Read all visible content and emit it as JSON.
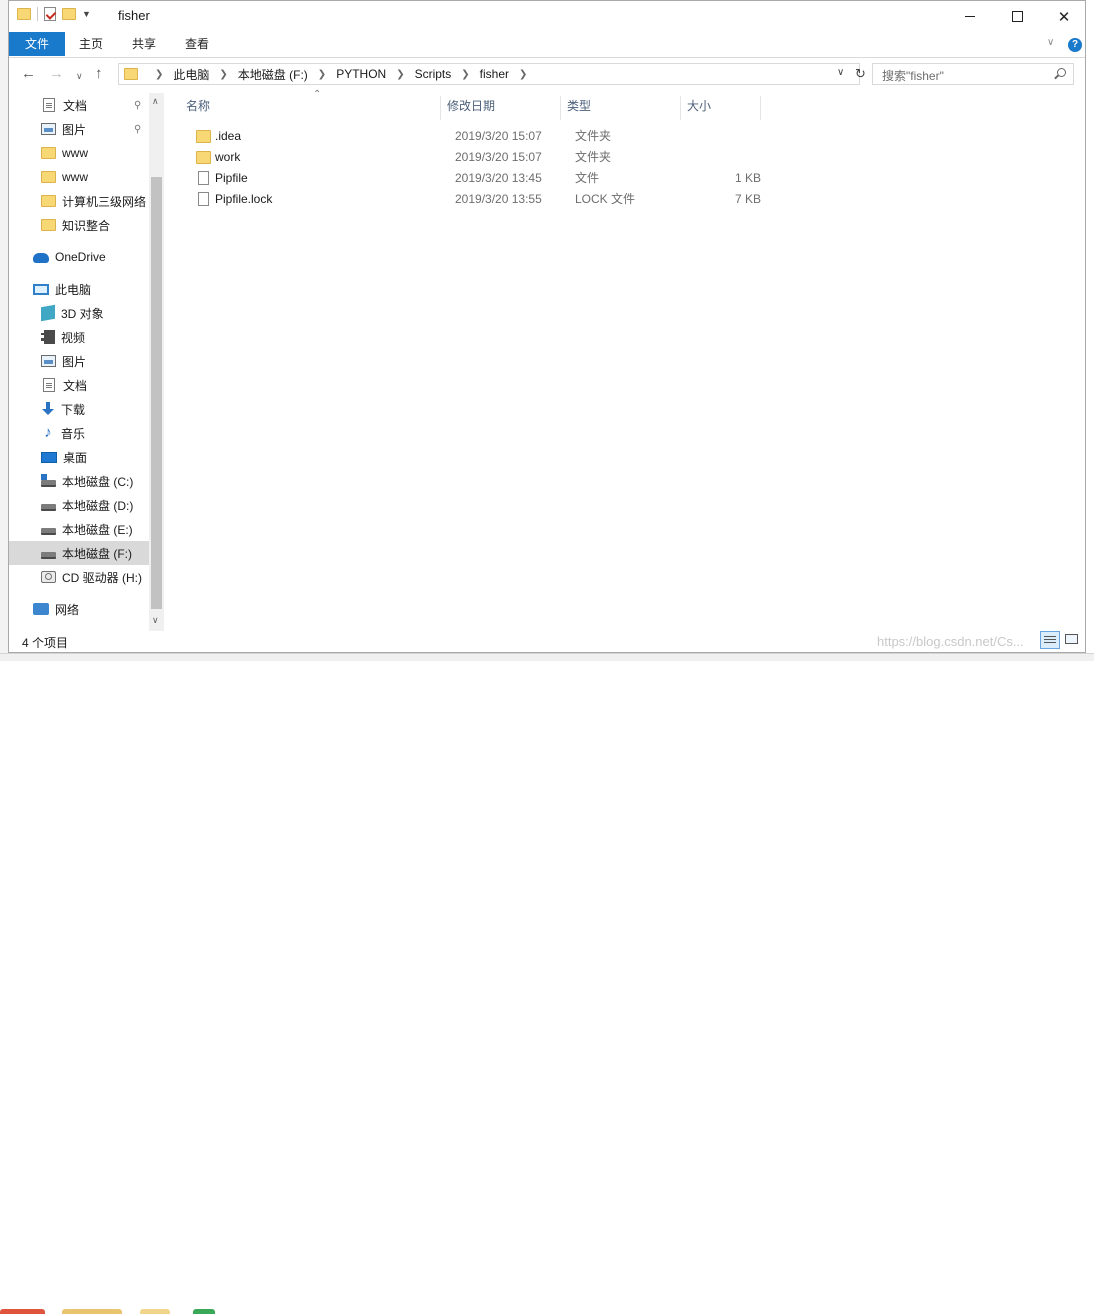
{
  "window": {
    "title": "fisher"
  },
  "ribbon": {
    "tabs": [
      "文件",
      "主页",
      "共享",
      "查看"
    ],
    "active_tab": "文件",
    "accent_color": "#1979ca"
  },
  "nav": {
    "breadcrumbs": [
      "此电脑",
      "本地磁盘 (F:)",
      "PYTHON",
      "Scripts",
      "fisher"
    ],
    "search_placeholder": "搜索\"fisher\""
  },
  "sidebar": {
    "quick_access": [
      {
        "label": "文档",
        "icon": "document-icon",
        "pinned": true
      },
      {
        "label": "图片",
        "icon": "picture-icon",
        "pinned": true
      },
      {
        "label": "www",
        "icon": "folder-icon",
        "pinned": false
      },
      {
        "label": "www",
        "icon": "folder-icon",
        "pinned": false
      },
      {
        "label": "计算机三级网络",
        "icon": "folder-icon",
        "pinned": false
      },
      {
        "label": "知识整合",
        "icon": "folder-icon",
        "pinned": false
      }
    ],
    "onedrive": {
      "label": "OneDrive",
      "icon": "cloud-icon"
    },
    "this_pc": {
      "label": "此电脑",
      "icon": "computer-icon"
    },
    "pc_items": [
      {
        "label": "3D 对象",
        "icon": "cube-3d-icon"
      },
      {
        "label": "视频",
        "icon": "video-icon"
      },
      {
        "label": "图片",
        "icon": "picture-icon"
      },
      {
        "label": "文档",
        "icon": "document-icon"
      },
      {
        "label": "下载",
        "icon": "download-icon"
      },
      {
        "label": "音乐",
        "icon": "music-icon"
      },
      {
        "label": "桌面",
        "icon": "desktop-icon"
      },
      {
        "label": "本地磁盘 (C:)",
        "icon": "system-drive-icon"
      },
      {
        "label": "本地磁盘 (D:)",
        "icon": "drive-icon"
      },
      {
        "label": "本地磁盘 (E:)",
        "icon": "drive-icon"
      },
      {
        "label": "本地磁盘 (F:)",
        "icon": "drive-icon",
        "selected": true
      },
      {
        "label": "CD 驱动器 (H:)",
        "icon": "cd-drive-icon"
      }
    ],
    "network": {
      "label": "网络",
      "icon": "network-icon"
    }
  },
  "filelist": {
    "columns": {
      "name": "名称",
      "date": "修改日期",
      "type": "类型",
      "size": "大小"
    },
    "files": [
      {
        "name": ".idea",
        "date": "2019/3/20 15:07",
        "type": "文件夹",
        "size": "",
        "kind": "folder"
      },
      {
        "name": "work",
        "date": "2019/3/20 15:07",
        "type": "文件夹",
        "size": "",
        "kind": "folder"
      },
      {
        "name": "Pipfile",
        "date": "2019/3/20 13:45",
        "type": "文件",
        "size": "1 KB",
        "kind": "file"
      },
      {
        "name": "Pipfile.lock",
        "date": "2019/3/20 13:55",
        "type": "LOCK 文件",
        "size": "7 KB",
        "kind": "file"
      }
    ]
  },
  "status": {
    "item_count": "4 个项目"
  },
  "watermark": "https://blog.csdn.net/Cs..."
}
